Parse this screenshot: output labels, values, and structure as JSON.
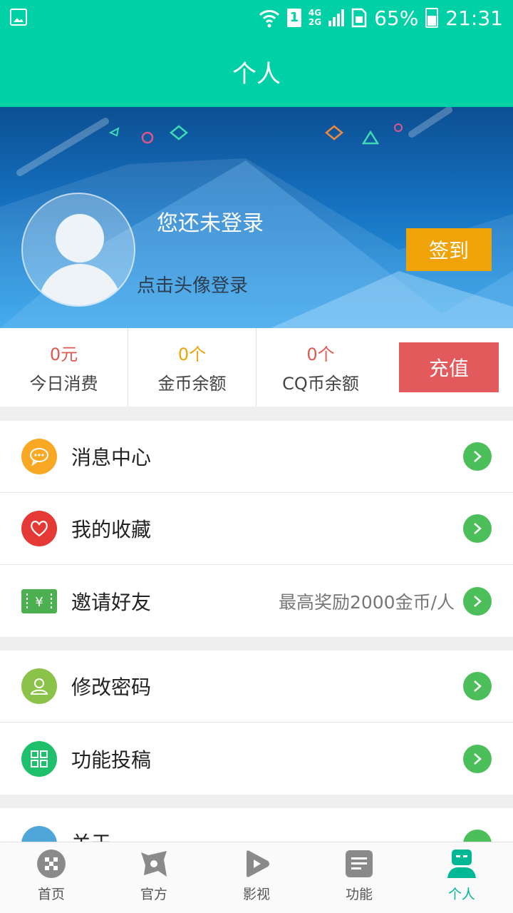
{
  "status_bar": {
    "net": "4G 2G",
    "sim": "1",
    "battery": "65%",
    "time": "21:31"
  },
  "header": {
    "title": "个人"
  },
  "profile": {
    "title": "您还未登录",
    "hint": "点击头像登录",
    "signin_label": "签到"
  },
  "stats": [
    {
      "value": "0元",
      "label": "今日消费",
      "color": "#e05a4f"
    },
    {
      "value": "0个",
      "label": "金币余额",
      "color": "#f0a209"
    },
    {
      "value": "0个",
      "label": "CQ币余额",
      "color": "#e05a4f"
    }
  ],
  "recharge_label": "充值",
  "menu_group1": [
    {
      "label": "消息中心",
      "icon": "message-icon",
      "color": "#f9a825",
      "extra": ""
    },
    {
      "label": "我的收藏",
      "icon": "heart-icon",
      "color": "#e53935",
      "extra": ""
    },
    {
      "label": "邀请好友",
      "icon": "ticket-icon",
      "color": "#4caf50",
      "extra": "最高奖励2000金币/人"
    }
  ],
  "menu_group2": [
    {
      "label": "修改密码",
      "icon": "user-icon",
      "color": "#8bc34a",
      "extra": ""
    },
    {
      "label": "功能投稿",
      "icon": "grid-icon",
      "color": "#1ec06b",
      "extra": ""
    }
  ],
  "menu_group3": [
    {
      "label": "关于",
      "icon": "about-icon",
      "color": "#4fa6d8",
      "extra": ""
    }
  ],
  "tabs": [
    {
      "label": "首页",
      "icon": "home-icon",
      "active": false
    },
    {
      "label": "官方",
      "icon": "official-icon",
      "active": false
    },
    {
      "label": "影视",
      "icon": "video-icon",
      "active": false
    },
    {
      "label": "功能",
      "icon": "features-icon",
      "active": false
    },
    {
      "label": "个人",
      "icon": "person-icon",
      "active": true
    }
  ]
}
